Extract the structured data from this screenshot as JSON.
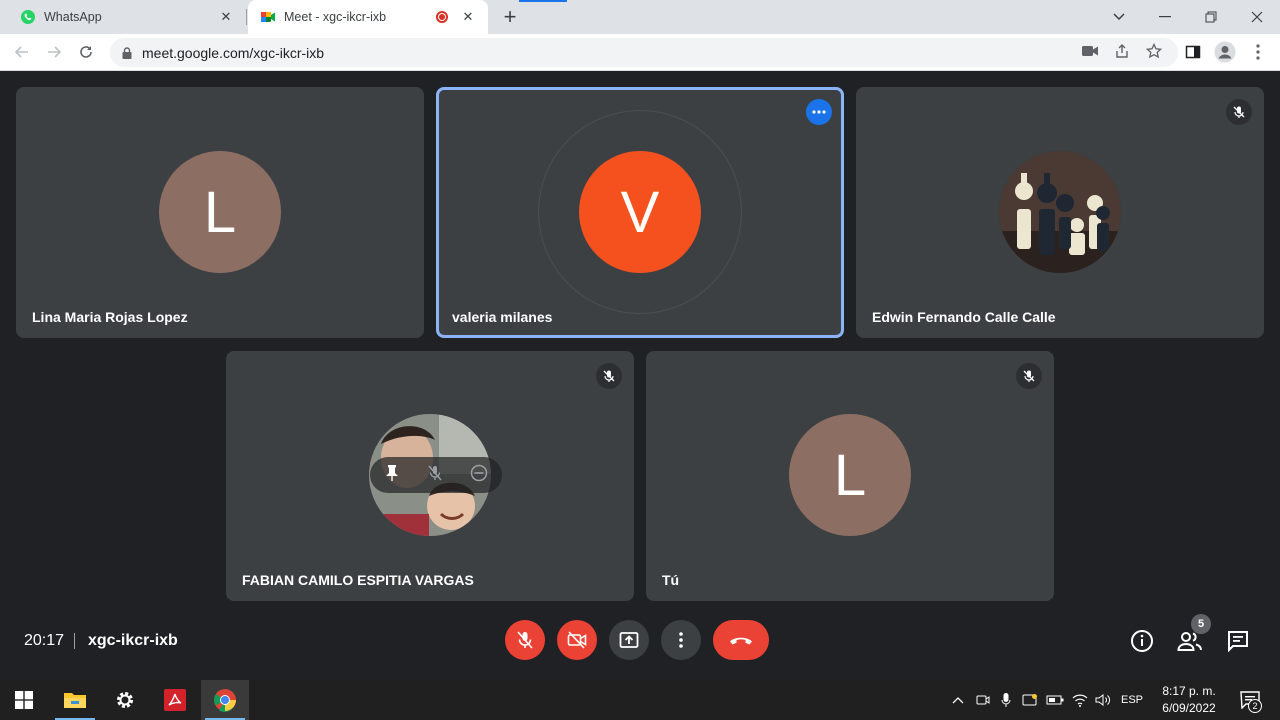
{
  "browser": {
    "tabs": [
      {
        "title": "WhatsApp",
        "icon": "whatsapp-icon",
        "active": false
      },
      {
        "title": "Meet - xgc-ikcr-ixb",
        "icon": "meet-icon",
        "active": true,
        "recording": true
      }
    ],
    "url": "meet.google.com/xgc-ikcr-ixb"
  },
  "meet": {
    "participants": [
      {
        "name": "Lina Maria Rojas Lopez",
        "initial": "L",
        "avatar_color": "#8d6e63",
        "muted": false
      },
      {
        "name": "valeria milanes",
        "initial": "V",
        "avatar_color": "#f4511e",
        "muted": false,
        "speaking": true
      },
      {
        "name": "Edwin Fernando Calle Calle",
        "initial": "",
        "avatar": "chess-pieces-photo",
        "muted": true
      },
      {
        "name": "FABIAN CAMILO ESPITIA VARGAS",
        "initial": "",
        "avatar": "profile-photo",
        "muted": true
      },
      {
        "name": "Tú",
        "initial": "L",
        "avatar_color": "#8d6e63",
        "muted": true
      }
    ],
    "time": "20:17",
    "meeting_code": "xgc-ikcr-ixb",
    "participant_count": "5",
    "colors": {
      "end_call": "#ea4335",
      "active_border": "#8ab4f8",
      "tile_bg": "#3c4043"
    }
  },
  "taskbar": {
    "language": "ESP",
    "time": "8:17 p. m.",
    "date": "6/09/2022",
    "notifications": "2"
  }
}
